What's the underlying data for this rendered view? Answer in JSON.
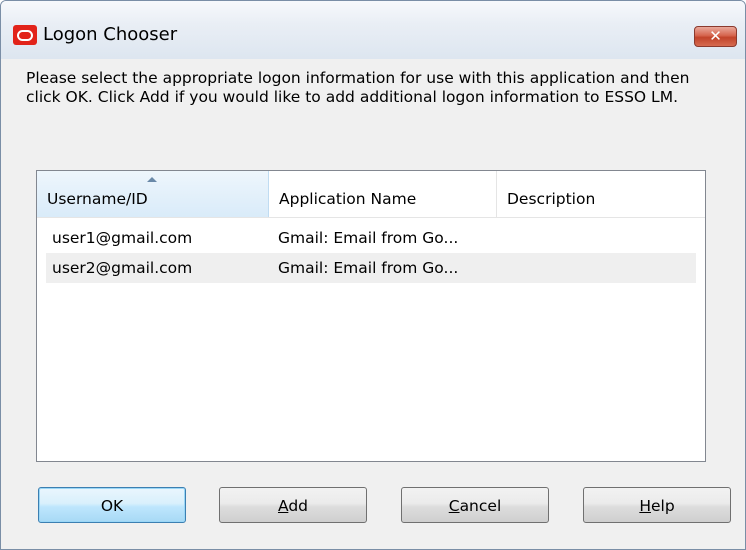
{
  "window": {
    "title": "Logon Chooser",
    "close_glyph": "✕",
    "icon": "oracle-logo-icon"
  },
  "instructions": "Please select the appropriate logon information for use with this application and then click OK. Click Add if you would like to add additional logon information to ESSO LM.",
  "list": {
    "columns": [
      "Username/ID",
      "Application Name",
      "Description"
    ],
    "sort_column": "Username/ID",
    "sort_direction": "ascending",
    "rows": [
      {
        "username": "user1@gmail.com",
        "application": "Gmail: Email from Go...",
        "description": ""
      },
      {
        "username": "user2@gmail.com",
        "application": "Gmail: Email from Go...",
        "description": ""
      }
    ]
  },
  "buttons": {
    "ok": {
      "label": "OK",
      "accel": ""
    },
    "add": {
      "label": "Add",
      "accel": "A"
    },
    "cancel": {
      "label": "Cancel",
      "accel": "C"
    },
    "help": {
      "label": "Help",
      "accel": "H"
    }
  },
  "colors": {
    "brand_red": "#e2231a",
    "close_red": "#c1432a",
    "selection_blue": "#d9ebf9",
    "default_button_border": "#3c7fb1"
  }
}
